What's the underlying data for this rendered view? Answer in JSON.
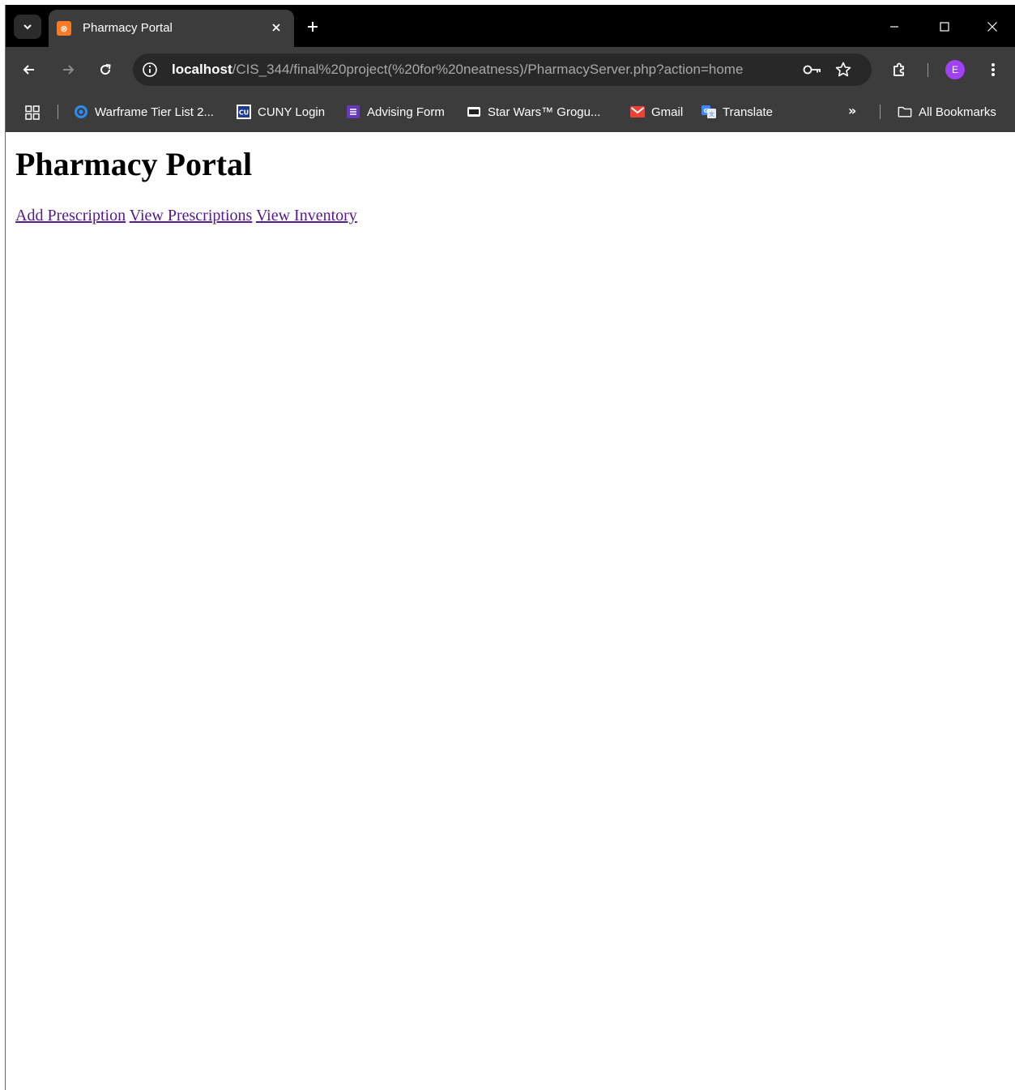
{
  "browser": {
    "tab": {
      "title": "Pharmacy Portal",
      "favicon_text": "⊗"
    },
    "address": {
      "host": "localhost",
      "path": "/CIS_344/final%20project(%20for%20neatness)/PharmacyServer.php?action=home"
    },
    "avatar_letter": "E",
    "bookmarks": [
      {
        "label": "Warframe Tier List 2...",
        "icon": "warframe-icon"
      },
      {
        "label": "CUNY Login",
        "icon": "cuny-icon"
      },
      {
        "label": "Advising Form",
        "icon": "forms-icon"
      },
      {
        "label": "Star Wars™ Grogu...",
        "icon": "lego-icon"
      },
      {
        "label": "Gmail",
        "icon": "gmail-icon"
      },
      {
        "label": "Translate",
        "icon": "translate-icon"
      }
    ],
    "all_bookmarks_label": "All Bookmarks",
    "more_label": "»"
  },
  "page": {
    "heading": "Pharmacy Portal",
    "links": {
      "add": "Add Prescription",
      "view_prescriptions": "View Prescriptions",
      "view_inventory": "View Inventory"
    }
  },
  "colors": {
    "tab_strip": "#000000",
    "toolbar": "#3c3c3c",
    "omnibox": "#282828",
    "visited_link": "#551a8b",
    "avatar": "#a142f4",
    "xampp_orange": "#fb7a24"
  }
}
